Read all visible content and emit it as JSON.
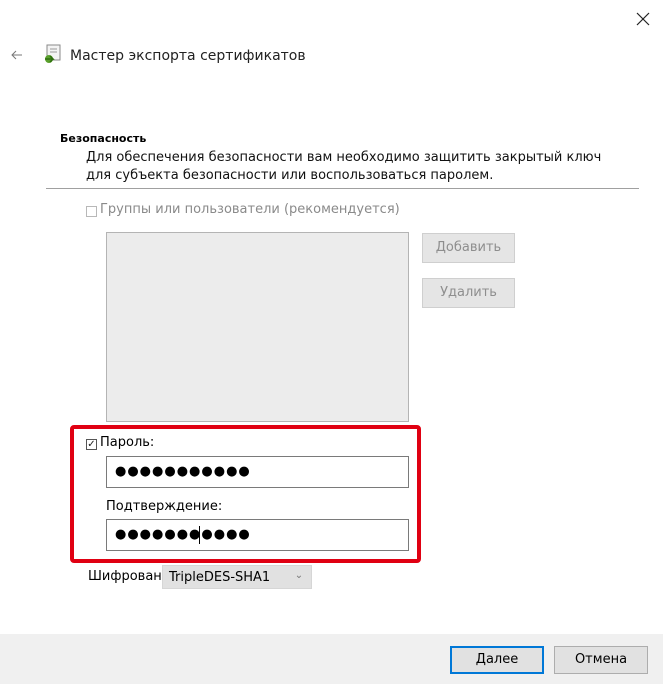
{
  "window": {
    "title": "Мастер экспорта сертификатов",
    "close_icon": "close-icon",
    "back_icon": "back-arrow-icon",
    "wizard_icon": "certificate-wizard-icon"
  },
  "section": {
    "title": "Безопасность",
    "description": "Для обеспечения безопасности вам необходимо защитить закрытый ключ для субъекта безопасности или воспользоваться паролем."
  },
  "groups": {
    "label": "Группы или пользователи (рекомендуется)",
    "checked": false,
    "enabled": false,
    "add_label": "Добавить",
    "remove_label": "Удалить"
  },
  "password": {
    "checkbox_label": "Пароль:",
    "checked": true,
    "check_mark": "✓",
    "value_masked": "●●●●●●●●●●●",
    "confirm_label": "Подтверждение:",
    "confirm_value_masked": "●●●●●●●●●●●"
  },
  "encryption": {
    "label": "Шифровани",
    "selected": "TripleDES-SHA1",
    "chevron": "⌄"
  },
  "footer": {
    "next_label": "Далее",
    "cancel_label": "Отмена"
  },
  "colors": {
    "highlight": "#e00012",
    "focus_border": "#0078d7",
    "footer_bg": "#f0f0f0"
  }
}
